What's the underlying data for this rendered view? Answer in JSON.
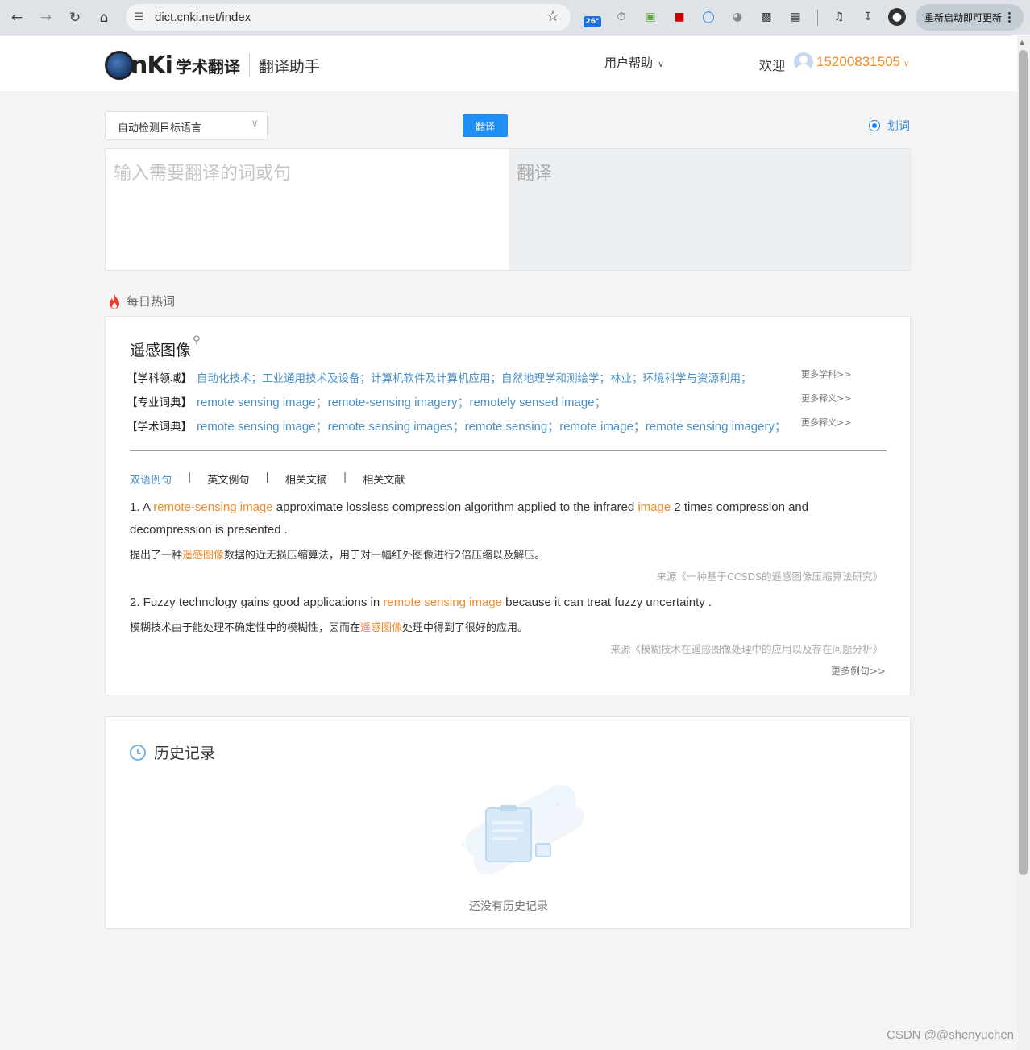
{
  "browser": {
    "url": "dict.cnki.net/index",
    "weather_badge": "26°",
    "restart_label": "重新启动即可更新"
  },
  "header": {
    "logo_text": "nKi",
    "brand": "学术翻译",
    "subtitle": "翻译助手",
    "help_menu": "用户帮助",
    "welcome": "欢迎",
    "user_phone": "15200831505"
  },
  "translate": {
    "language_select": "自动检测目标语言",
    "translate_button": "翻译",
    "word_pick_label": "划词",
    "input_placeholder": "输入需要翻译的词或句",
    "output_placeholder": "翻译"
  },
  "hot": {
    "section_title": "每日热词",
    "word": "遥感图像",
    "definitions": [
      {
        "tag": "【学科领域】",
        "items": "自动化技术；工业通用技术及设备；计算机软件及计算机应用；自然地理学和测绘学；林业；环境科学与资源利用；",
        "more": "更多学科>>"
      },
      {
        "tag": "【专业词典】",
        "items": "remote sensing image；remote-sensing imagery；remotely sensed image；",
        "more": "更多释义>>"
      },
      {
        "tag": "【学术词典】",
        "items": "remote sensing image；remote sensing images；remote sensing；remote image；remote sensing imagery；",
        "more": "更多释义>>"
      }
    ],
    "tabs": [
      "双语例句",
      "英文例句",
      "相关文摘",
      "相关文献"
    ],
    "examples": [
      {
        "en_prefix": "1. A ",
        "en_hl1": "remote-sensing image",
        "en_mid": " approximate lossless compression algorithm applied to the infrared ",
        "en_hl2": "image",
        "en_suffix": " 2 times compression and decompression is presented .",
        "zh_prefix": "提出了一种",
        "zh_hl": "遥感图像",
        "zh_suffix": "数据的近无损压缩算法，用于对一幅红外图像进行2倍压缩以及解压。",
        "source": "来源《一种基于CCSDS的遥感图像压缩算法研究》"
      },
      {
        "en_prefix": "2. Fuzzy technology gains good applications in ",
        "en_hl1": "remote sensing image",
        "en_mid": " because it can treat fuzzy uncertainty .",
        "zh_prefix": "模糊技术由于能处理不确定性中的模糊性，因而在",
        "zh_hl": "遥感图像",
        "zh_suffix": "处理中得到了很好的应用。",
        "source": "来源《模糊技术在遥感图像处理中的应用以及存在问题分析》"
      }
    ],
    "more_examples": "更多例句>>"
  },
  "history": {
    "title": "历史记录",
    "empty_text": "还没有历史记录"
  },
  "watermark": "CSDN @@shenyuchen",
  "colors": {
    "accent_blue": "#1e90f5",
    "link_blue": "#4a90c8",
    "highlight_orange": "#f08a2c"
  }
}
